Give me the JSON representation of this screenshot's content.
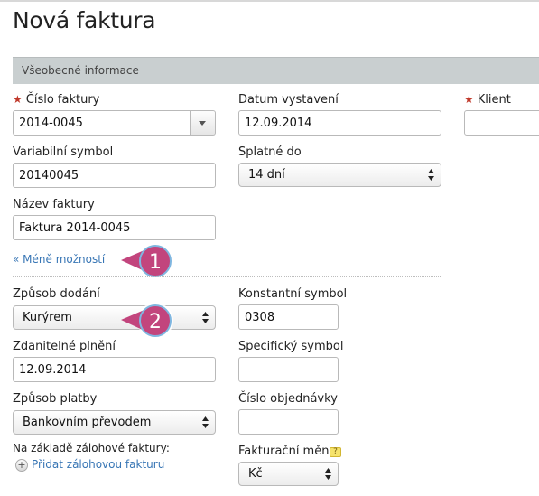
{
  "page": {
    "title": "Nová faktura"
  },
  "section": {
    "title": "Všeobecné informace"
  },
  "required_mark": "★",
  "fields": {
    "cislo_faktury": {
      "label": "Číslo faktury",
      "value": "2014-0045"
    },
    "datum_vystaveni": {
      "label": "Datum vystavení",
      "value": "12.09.2014"
    },
    "klient": {
      "label": "Klient",
      "value": ""
    },
    "variabilni_symbol": {
      "label": "Variabilní symbol",
      "value": "20140045"
    },
    "splatne_do": {
      "label": "Splatné do",
      "value": "14 dní"
    },
    "nazev_faktury": {
      "label": "Název faktury",
      "value": "Faktura 2014-0045"
    },
    "zpusob_dodani": {
      "label": "Způsob dodání",
      "value": "Kurýrem"
    },
    "konstantni_symbol": {
      "label": "Konstantní symbol",
      "value": "0308"
    },
    "zdanitelne_plneni": {
      "label": "Zdanitelné plnění",
      "value": "12.09.2014"
    },
    "specificky_symbol": {
      "label": "Specifický symbol",
      "value": ""
    },
    "zpusob_platby": {
      "label": "Způsob platby",
      "value": "Bankovním převodem"
    },
    "cislo_objednavky": {
      "label": "Číslo objednávky",
      "value": ""
    },
    "zalohova_faktura": {
      "label": "Na základě zálohové faktury:",
      "link": "Přidat zálohovou fakturu"
    },
    "fakturacni_mena": {
      "label": "Fakturační měna",
      "value": "Kč"
    }
  },
  "links": {
    "less_options": "« Méně možností"
  },
  "callouts": [
    {
      "number": "1",
      "color": "#c2457d"
    },
    {
      "number": "2",
      "color": "#c2457d"
    }
  ],
  "icons": {
    "dropdown": "chevron-down-icon",
    "select": "updown-arrows-icon",
    "add": "plus-icon",
    "help": "help-icon"
  }
}
